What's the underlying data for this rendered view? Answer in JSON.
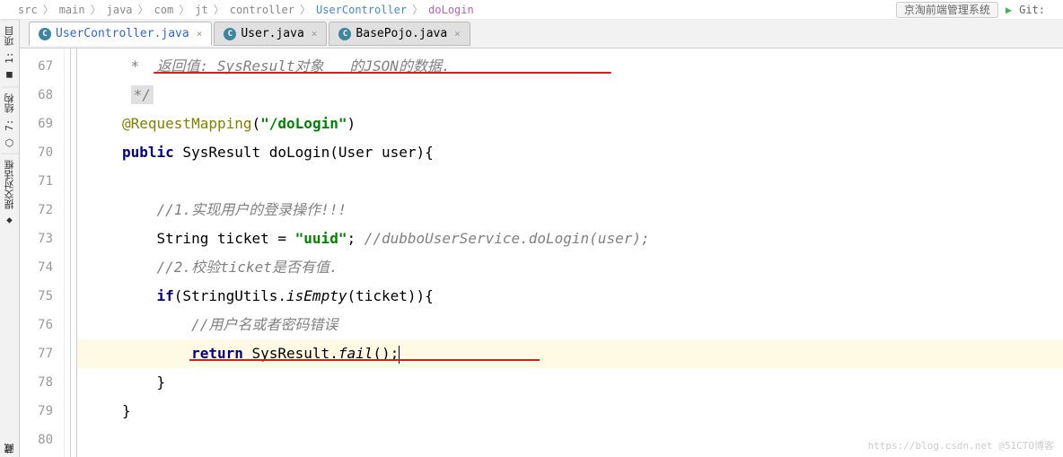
{
  "breadcrumb": {
    "items": [
      "src",
      "main",
      "java",
      "com",
      "jt",
      "controller",
      "UserController",
      "doLogin"
    ]
  },
  "toolbar": {
    "runConfig": "京淘前端管理系统",
    "gitLabel": "Git:"
  },
  "sidebar": {
    "tabs": [
      {
        "label": "1: 项目",
        "icon": "■"
      },
      {
        "label": "7: 结构",
        "icon": "⬡"
      },
      {
        "label": "提交对话框",
        "icon": "◆"
      }
    ],
    "bottom": "藏"
  },
  "editorTabs": [
    {
      "label": "UserController.java",
      "active": true
    },
    {
      "label": "User.java",
      "active": false
    },
    {
      "label": "BasePojo.java",
      "active": false
    }
  ],
  "gutter": {
    "start": 67,
    "end": 80
  },
  "code": {
    "l67_star": "*  ",
    "l67_text": "返回值: SysResult对象   的JSON的数据.",
    "l68": "*/",
    "l69": "@RequestMapping",
    "l69_paren_open": "(",
    "l69_str": "\"/doLogin\"",
    "l69_paren_close": ")",
    "l70_kw1": "public",
    "l70_type": " SysResult ",
    "l70_method": "doLogin",
    "l70_sig": "(User user){",
    "l71": "",
    "l72": "//1.实现用户的登录操作!!!",
    "l73_a": "String ticket = ",
    "l73_str": "\"uuid\"",
    "l73_b": "; ",
    "l73_c": "//dubboUserService.doLogin(user);",
    "l74": "//2.校验ticket是否有值.",
    "l75_a": "if",
    "l75_b": "(StringUtils.",
    "l75_c": "isEmpty",
    "l75_d": "(ticket)){",
    "l76": "//用户名或者密码错误",
    "l77_a": "return",
    "l77_b": " SysResult.",
    "l77_c": "fail",
    "l77_d": "();",
    "l78": "}",
    "l79": "}"
  },
  "watermark": "https://blog.csdn.net @51CTO博客"
}
